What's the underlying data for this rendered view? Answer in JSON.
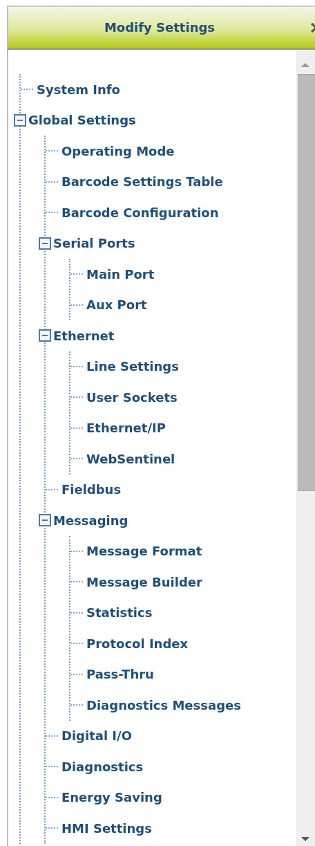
{
  "panel": {
    "title": "Modify Settings"
  },
  "tree": [
    {
      "label": "System Info"
    },
    {
      "label": "Global Settings",
      "expanded": true,
      "children": [
        {
          "label": "Operating Mode"
        },
        {
          "label": "Barcode Settings Table"
        },
        {
          "label": "Barcode Configuration"
        },
        {
          "label": "Serial Ports",
          "expanded": true,
          "children": [
            {
              "label": "Main Port"
            },
            {
              "label": "Aux Port"
            }
          ]
        },
        {
          "label": "Ethernet",
          "expanded": true,
          "children": [
            {
              "label": "Line Settings"
            },
            {
              "label": "User Sockets"
            },
            {
              "label": "Ethernet/IP"
            },
            {
              "label": "WebSentinel"
            }
          ]
        },
        {
          "label": "Fieldbus"
        },
        {
          "label": "Messaging",
          "expanded": true,
          "children": [
            {
              "label": "Message Format"
            },
            {
              "label": "Message Builder"
            },
            {
              "label": "Statistics"
            },
            {
              "label": "Protocol Index"
            },
            {
              "label": "Pass-Thru"
            },
            {
              "label": "Diagnostics Messages"
            }
          ]
        },
        {
          "label": "Digital I/O"
        },
        {
          "label": "Diagnostics"
        },
        {
          "label": "Energy Saving"
        },
        {
          "label": "HMI Settings"
        }
      ]
    }
  ]
}
